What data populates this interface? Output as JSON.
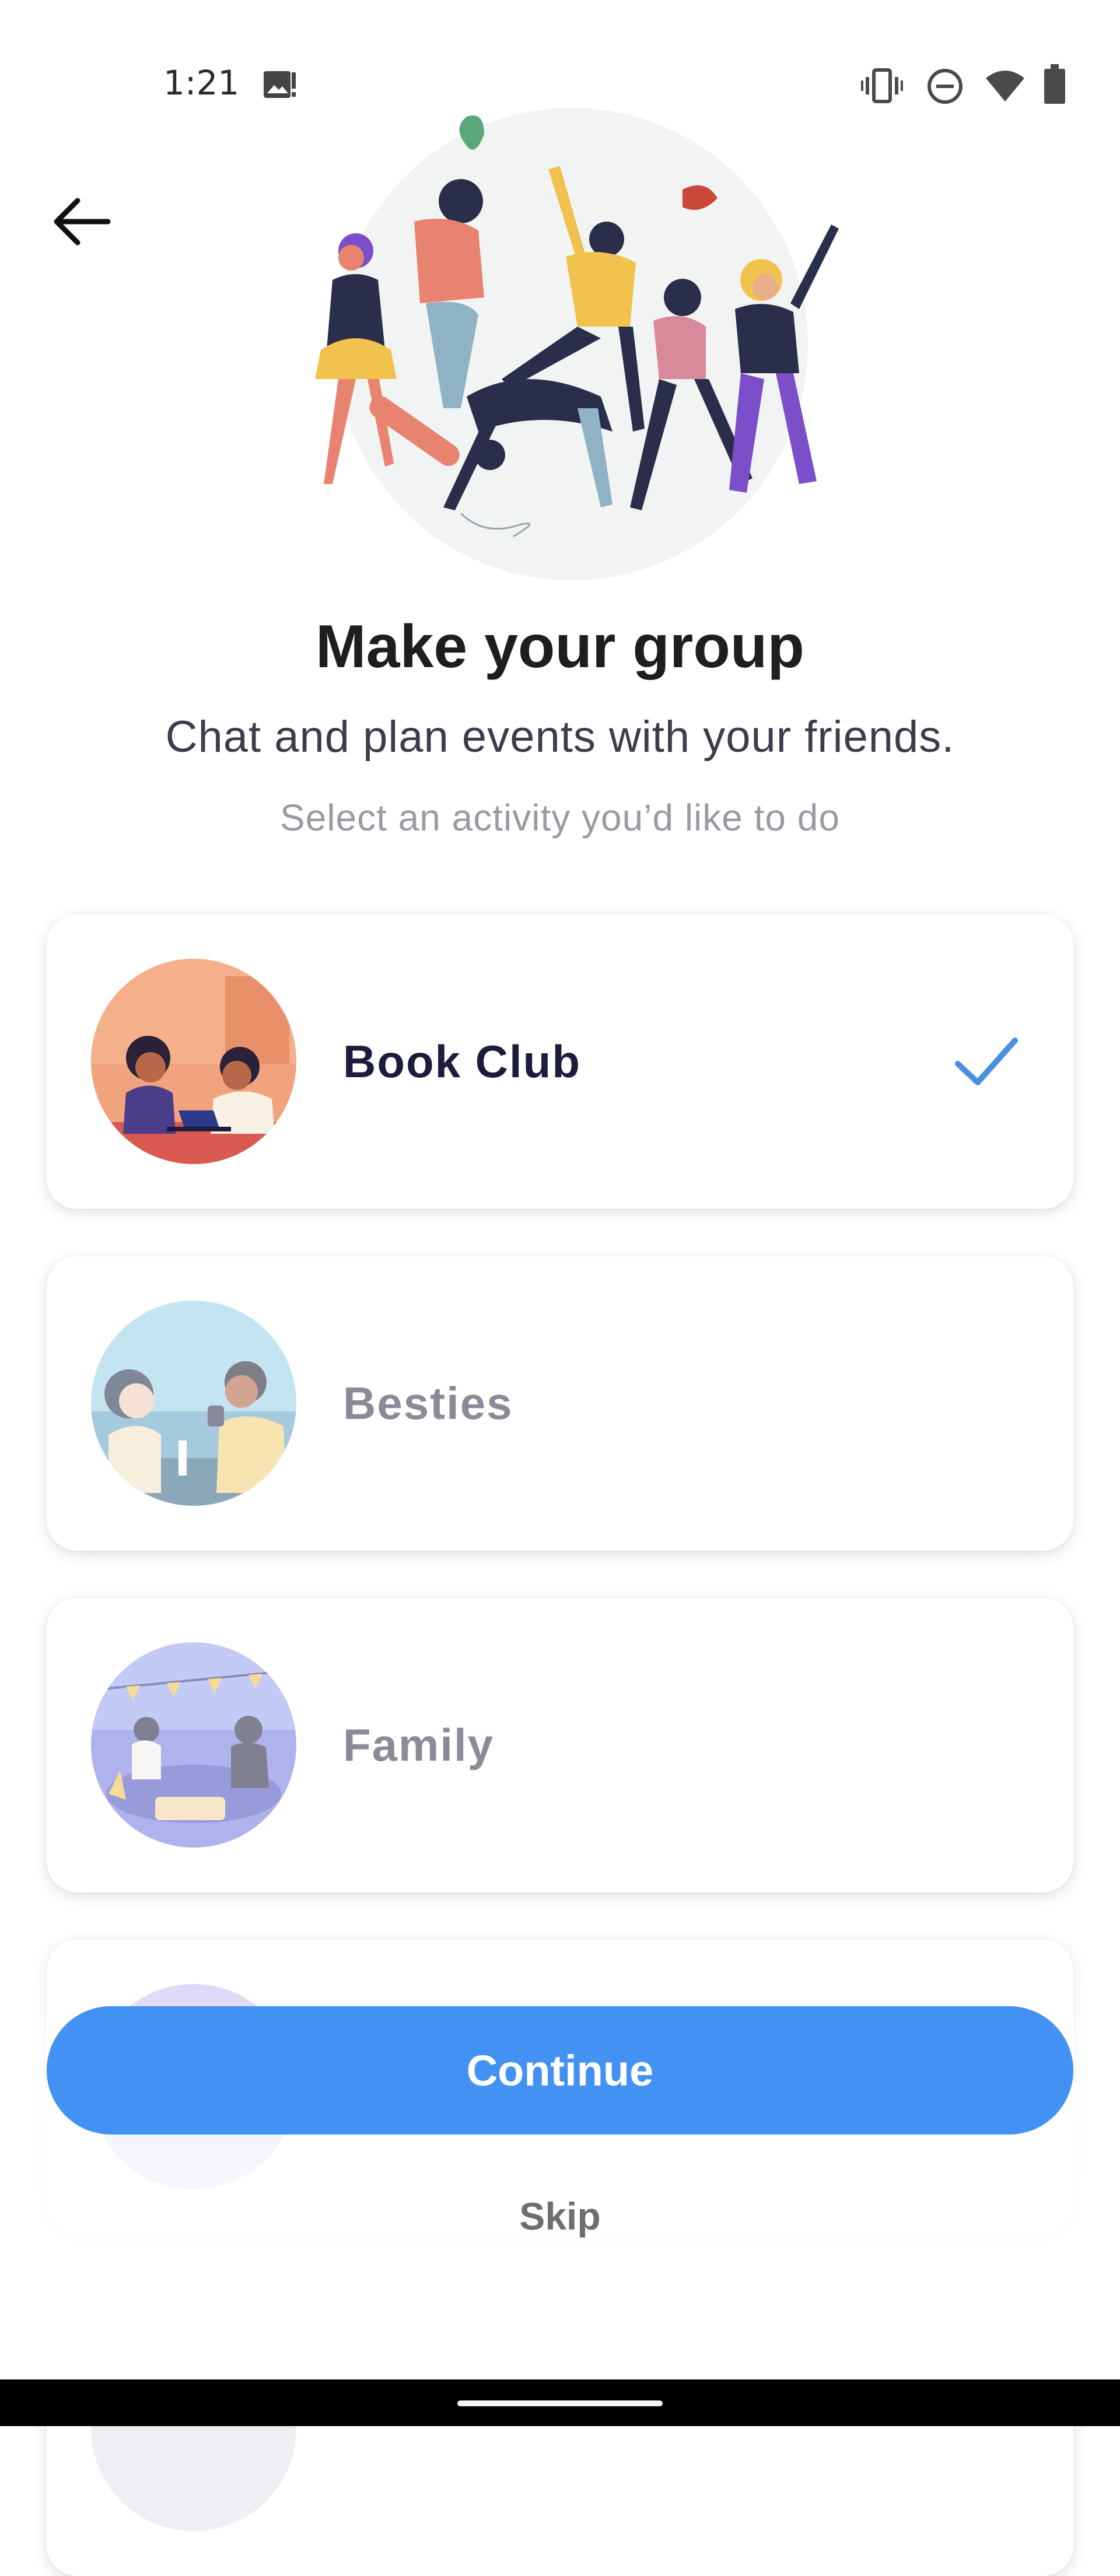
{
  "status_bar": {
    "time": "1:21",
    "icons": [
      "image-notification-icon",
      "vibrate-icon",
      "do-not-disturb-icon",
      "wifi-icon",
      "battery-icon"
    ]
  },
  "header": {
    "back_icon": "arrow-left-icon"
  },
  "hero": {
    "illustration": "group-dancing-illustration"
  },
  "main": {
    "title": "Make your group",
    "subtitle": "Chat and plan events with your friends.",
    "hint": "Select an activity you’d like to do"
  },
  "activities": [
    {
      "label": "Book Club",
      "selected": true,
      "icon": "book-club-illustration"
    },
    {
      "label": "Besties",
      "selected": false,
      "icon": "besties-illustration"
    },
    {
      "label": "Family",
      "selected": false,
      "icon": "family-illustration"
    }
  ],
  "actions": {
    "continue_label": "Continue",
    "skip_label": "Skip"
  },
  "colors": {
    "accent": "#4392f3",
    "check": "#4a90e2",
    "title": "#1e1e21",
    "muted": "#8a8b98"
  }
}
